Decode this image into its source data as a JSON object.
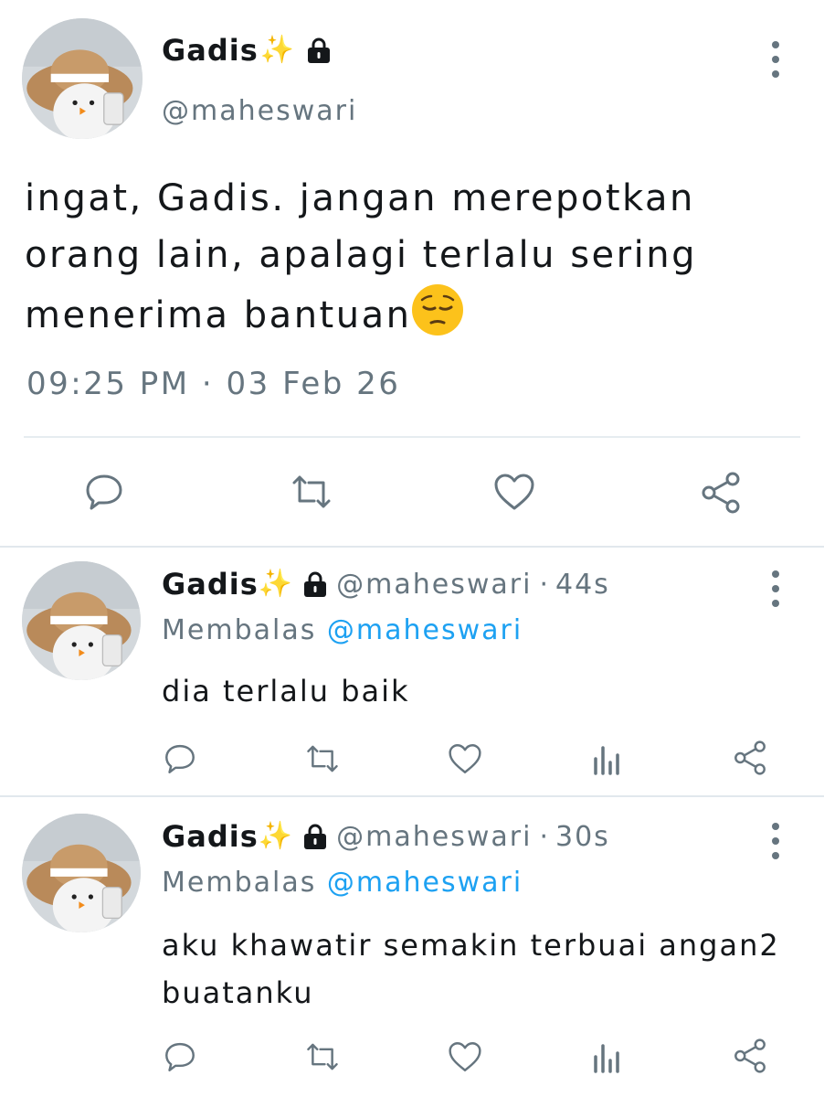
{
  "main_tweet": {
    "display_name": "Gadis",
    "handle": "@maheswari",
    "text": "ingat, Gadis. jangan merepotkan orang lain, apalagi terlalu sering menerima bantuan",
    "timestamp": "09:25 PM · 03 Feb 26",
    "icons": [
      "sparkles-icon",
      "lock-icon",
      "more-icon",
      "pensive-face-emoji",
      "reply-icon",
      "retweet-icon",
      "like-icon",
      "share-icon"
    ]
  },
  "replies": [
    {
      "display_name": "Gadis",
      "handle": "@maheswari",
      "separator": "·",
      "time": "44s",
      "replying_prefix": "Membalas",
      "replying_to": "@maheswari",
      "text": "dia terlalu baik"
    },
    {
      "display_name": "Gadis",
      "handle": "@maheswari",
      "separator": "·",
      "time": "30s",
      "replying_prefix": "Membalas",
      "replying_to": "@maheswari",
      "text": "aku khawatir semakin terbuai angan2 buatanku"
    }
  ],
  "colors": {
    "text": "#14171a",
    "secondary": "#66757f",
    "accent": "#1da1f2",
    "divider": "#e6ecf0"
  }
}
